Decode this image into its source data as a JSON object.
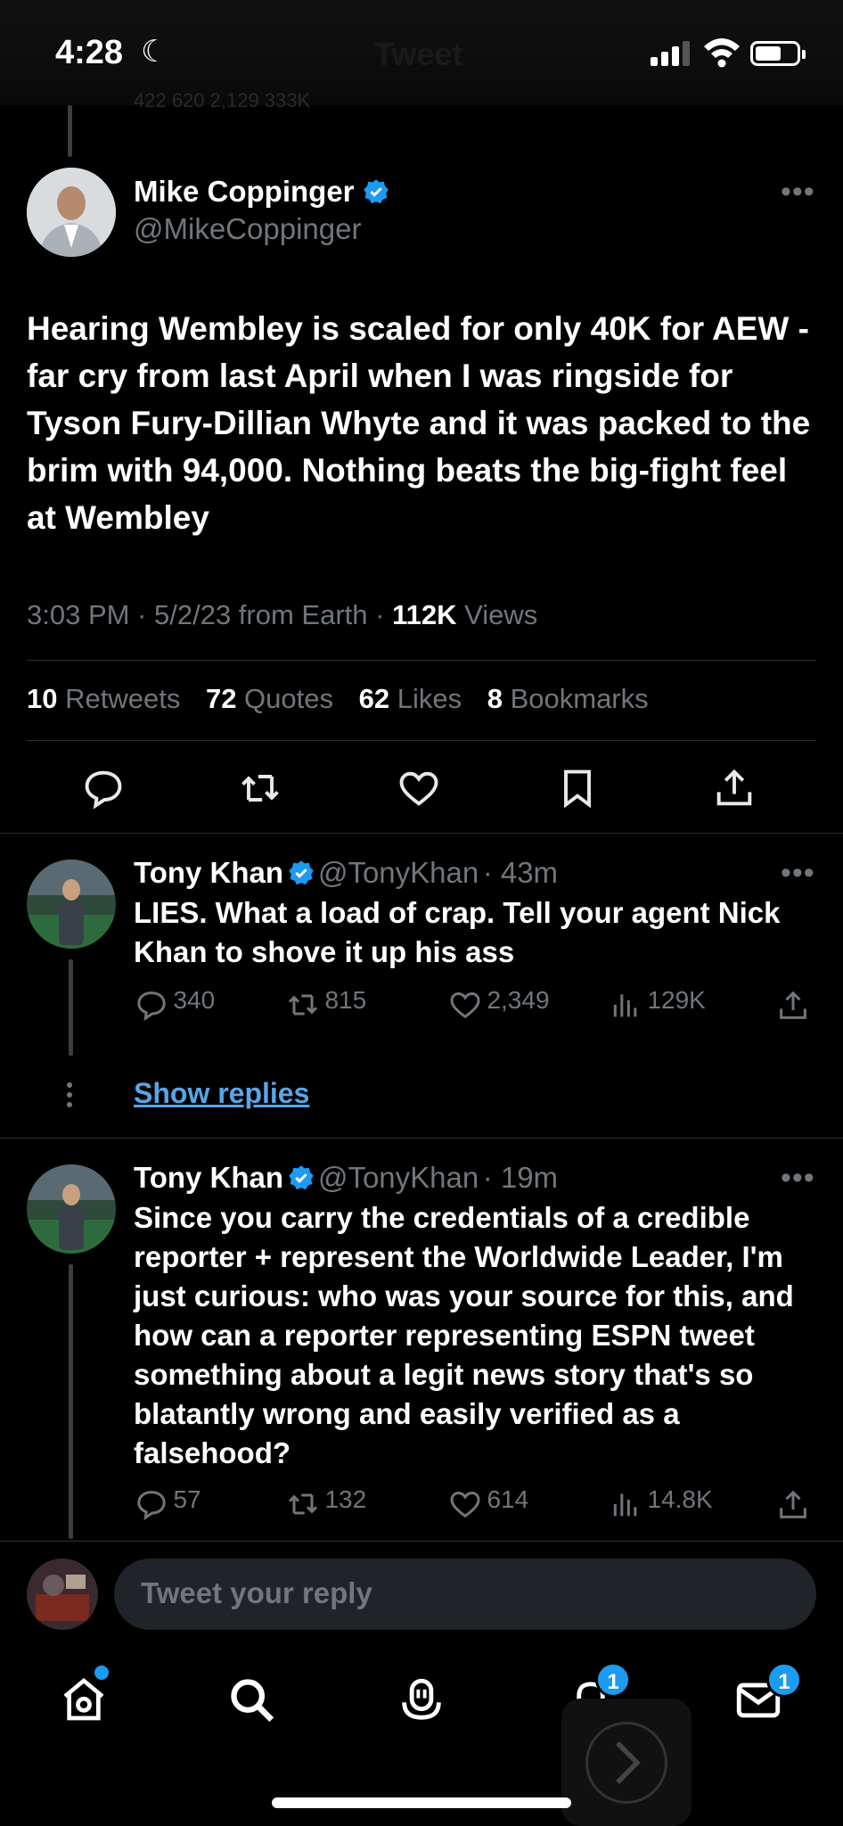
{
  "status_bar": {
    "time": "4:28",
    "moon": "☾",
    "ghost_title": "Tweet"
  },
  "ghost_counts": "  422        620         2,129        333K",
  "main_tweet": {
    "author_name": "Mike Coppinger",
    "author_handle": "@MikeCoppinger",
    "text": "Hearing Wembley is scaled for only 40K for AEW - far cry from last April when I was ringside for Tyson Fury-Dillian Whyte and it was packed to the brim with 94,000. Nothing beats the big-fight feel at Wembley",
    "meta_time": "3:03 PM · 5/2/23 from Earth · ",
    "views_count": "112K",
    "views_label": " Views",
    "stats": {
      "retweets_count": "10",
      "retweets_label": " Retweets",
      "quotes_count": "72",
      "quotes_label": " Quotes",
      "likes_count": "62",
      "likes_label": " Likes",
      "bookmarks_count": "8",
      "bookmarks_label": " Bookmarks"
    }
  },
  "replies": [
    {
      "author_name": "Tony Khan",
      "author_handle": "@TonyKhan",
      "time": "· 43m",
      "text": "LIES. What a load of crap. Tell your agent Nick Khan to shove it up his ass",
      "replies": "340",
      "retweets": "815",
      "likes": "2,349",
      "views": "129K"
    },
    {
      "author_name": "Tony Khan",
      "author_handle": "@TonyKhan",
      "time": "· 19m",
      "text": "Since you carry the credentials of a credible reporter + represent the Worldwide Leader, I'm just curious: who was your source for this, and how can a reporter representing ESPN tweet something about a legit news story that's so blatantly wrong and easily verified as a falsehood?",
      "replies": "57",
      "retweets": "132",
      "likes": "614",
      "views": "14.8K"
    }
  ],
  "show_replies": "Show replies",
  "compose": {
    "placeholder": "Tweet your reply"
  },
  "tabbar": {
    "notifications_badge": "1",
    "messages_badge": "1"
  },
  "colors": {
    "accent": "#1d9bf0",
    "link": "#58a6e6",
    "muted": "#71767b"
  }
}
